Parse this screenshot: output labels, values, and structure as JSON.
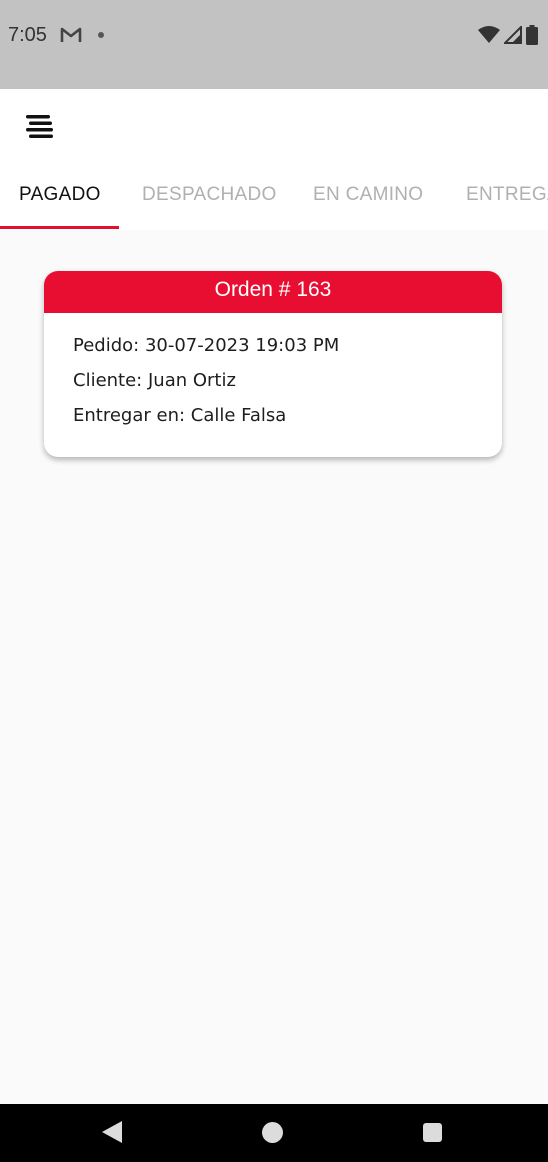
{
  "status_bar": {
    "time": "7:05",
    "icons": [
      "gmail-icon",
      "notification-dot-icon",
      "wifi-icon",
      "signal-icon",
      "battery-icon"
    ]
  },
  "app_bar": {
    "menu_icon": "menu-icon"
  },
  "tabs": [
    {
      "label": "PAGADO",
      "active": true
    },
    {
      "label": "DESPACHADO",
      "active": false
    },
    {
      "label": "EN CAMINO",
      "active": false
    },
    {
      "label": "ENTREGADO",
      "active": false
    }
  ],
  "order_card": {
    "title": "Orden # 163",
    "pedido": "Pedido: 30-07-2023 19:03 PM",
    "cliente": "Cliente: Juan Ortiz",
    "entregar": "Entregar en: Calle Falsa"
  },
  "colors": {
    "accent": "#e80e32",
    "status_bar": "#c2c2c2",
    "background": "#fafafa",
    "inactive_tab": "#b0b0b0"
  },
  "nav_bar": {
    "icons": [
      "back-icon",
      "home-icon",
      "recents-icon"
    ]
  }
}
